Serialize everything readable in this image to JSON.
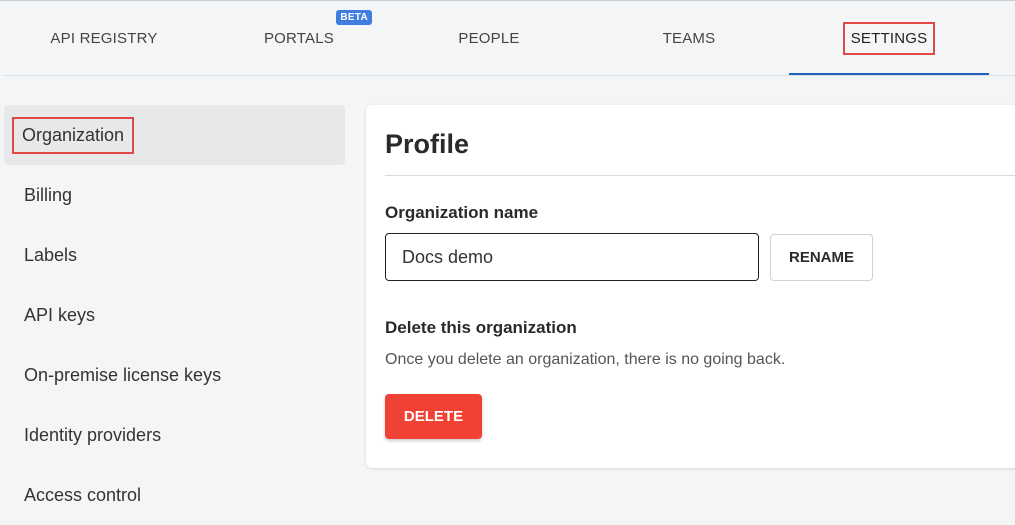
{
  "tabs": {
    "api_registry": "API REGISTRY",
    "portals": "PORTALS",
    "portals_badge": "BETA",
    "people": "PEOPLE",
    "teams": "TEAMS",
    "settings": "SETTINGS",
    "active": "SETTINGS"
  },
  "sidebar": {
    "items": [
      {
        "label": "Organization",
        "active": true
      },
      {
        "label": "Billing"
      },
      {
        "label": "Labels"
      },
      {
        "label": "API keys"
      },
      {
        "label": "On-premise license keys"
      },
      {
        "label": "Identity providers"
      },
      {
        "label": "Access control"
      }
    ]
  },
  "profile": {
    "title": "Profile",
    "org_name_label": "Organization name",
    "org_name_value": "Docs demo",
    "rename_label": "RENAME",
    "delete_heading": "Delete this organization",
    "delete_description": "Once you delete an organization, there is no going back.",
    "delete_label": "DELETE"
  },
  "colors": {
    "accent": "#1f5fbf",
    "highlight": "#e04848",
    "danger": "#f04134",
    "badge": "#3f7de0"
  }
}
